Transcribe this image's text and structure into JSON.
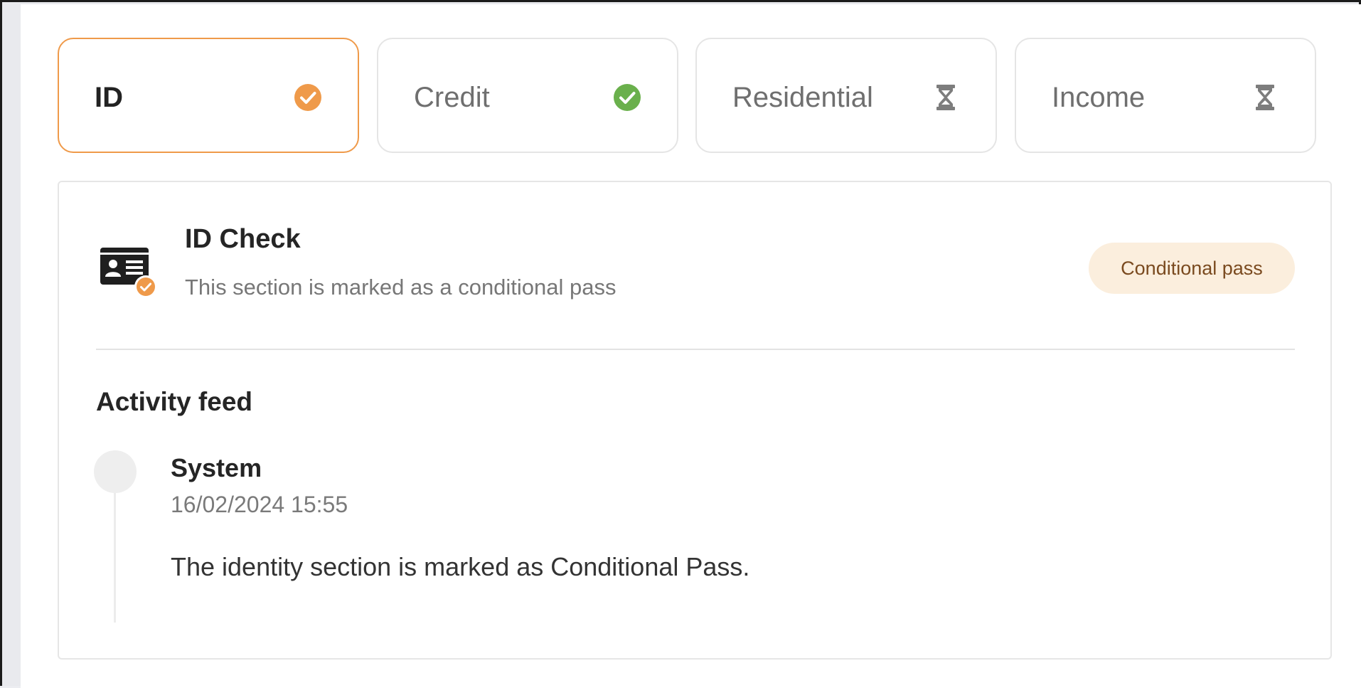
{
  "tabs": [
    {
      "label": "ID",
      "status_icon": "check-circle-orange-icon",
      "active": true
    },
    {
      "label": "Credit",
      "status_icon": "check-circle-green-icon",
      "active": false
    },
    {
      "label": "Residential",
      "status_icon": "hourglass-icon",
      "active": false
    },
    {
      "label": "Income",
      "status_icon": "hourglass-icon",
      "active": false
    }
  ],
  "section": {
    "icon": "id-card-check-icon",
    "title": "ID Check",
    "subtitle": "This section is marked as a conditional pass",
    "status": "Conditional pass"
  },
  "activity": {
    "heading": "Activity feed",
    "items": [
      {
        "author": "System",
        "timestamp": "16/02/2024 15:55",
        "message": "The identity section is marked as Conditional Pass."
      }
    ]
  },
  "colors": {
    "accent_orange": "#ef9a4a",
    "success_green": "#6ab04c",
    "badge_bg": "#fbeedd",
    "badge_text": "#7a4a1f",
    "hourglass_gray": "#7d7d7d"
  }
}
